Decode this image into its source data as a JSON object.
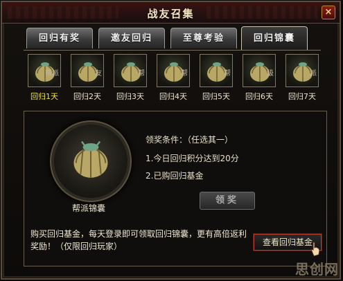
{
  "window": {
    "title": "战友召集",
    "close_label": "×"
  },
  "tabs": [
    {
      "label": "回归有奖",
      "active": false
    },
    {
      "label": "邀友回归",
      "active": false
    },
    {
      "label": "至尊考验",
      "active": false
    },
    {
      "label": "回归锦囊",
      "active": true
    }
  ],
  "rewards": [
    {
      "day": "回归1天",
      "tag": "帮派"
    },
    {
      "day": "回归2天",
      "tag": "友"
    },
    {
      "day": "回归3天",
      "tag": "帮"
    },
    {
      "day": "回归4天",
      "tag": "帮"
    },
    {
      "day": "回归5天",
      "tag": "帮"
    },
    {
      "day": "回归6天",
      "tag": "级"
    },
    {
      "day": "回归7天",
      "tag": "派"
    }
  ],
  "featured": {
    "label": "帮派锦囊"
  },
  "conditions": {
    "title": "领奖条件：（任选其一）",
    "items": [
      "1.今日回归积分达到20分",
      "2.已购回归基金"
    ]
  },
  "claim_button": {
    "label": "领奖",
    "enabled": false
  },
  "description": "购买回归基金，每天登录即可领取回归锦囊，更有高倍返利奖励！（仅限回归玩家）",
  "fund_button": {
    "label": "查看回归基金"
  },
  "watermark": "思创网",
  "colors": {
    "highlight_day": "#f0e33a",
    "fund_border": "#c23a2a"
  }
}
